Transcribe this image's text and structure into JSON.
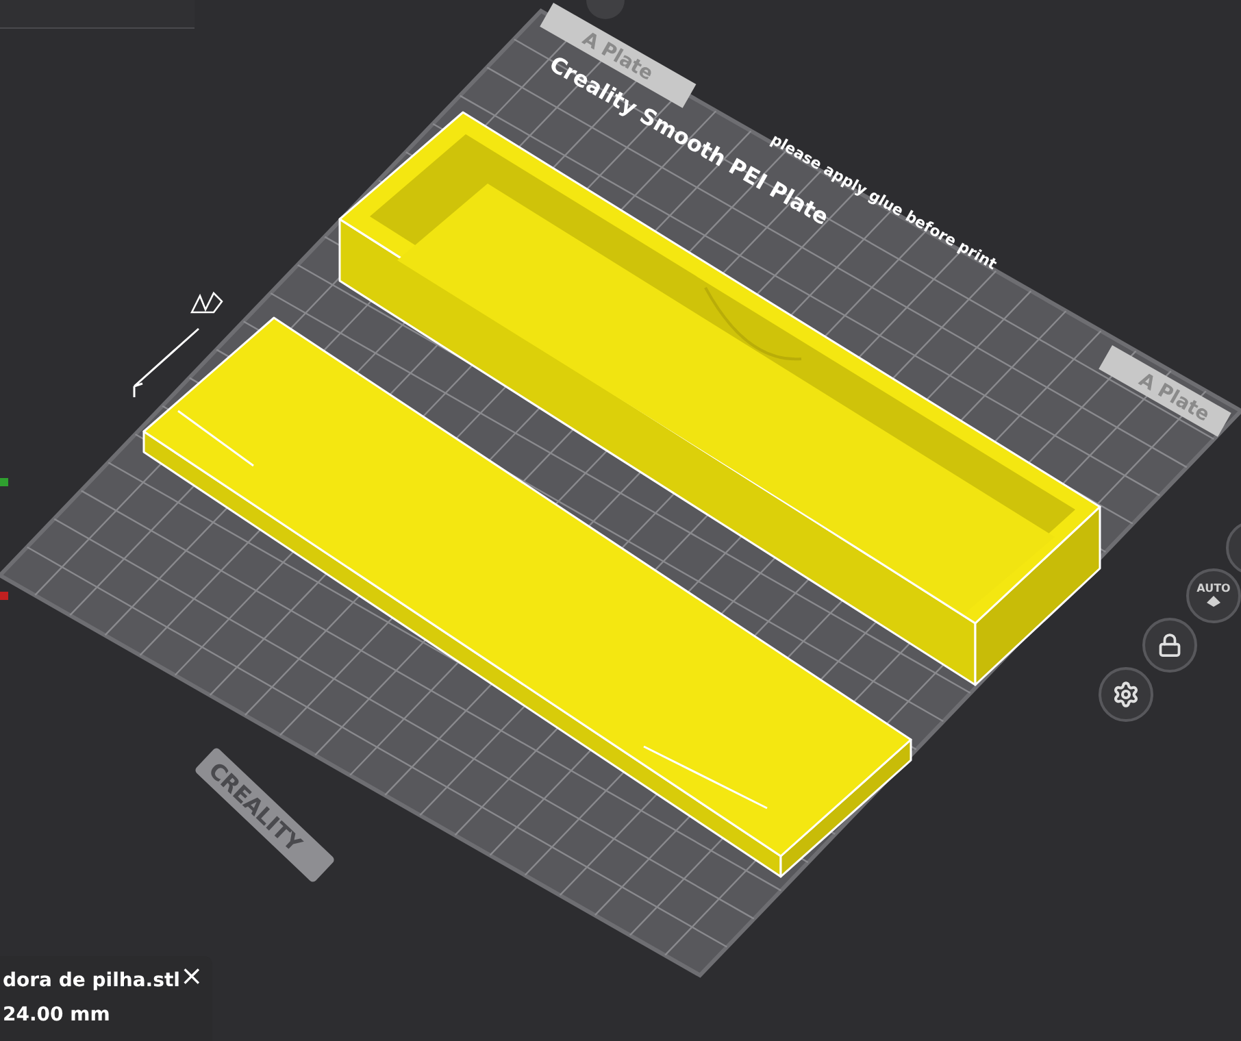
{
  "plate": {
    "tab_labels": [
      "A Plate",
      "A Plate"
    ],
    "name": "Creality Smooth PEI Plate",
    "note": "please apply glue before print",
    "logo": "CREALITY"
  },
  "toolbar": [
    {
      "kind": "auto",
      "label": "AUTO"
    },
    {
      "kind": "lock"
    },
    {
      "kind": "settings"
    }
  ],
  "object_info": {
    "name": "dora de pilha.stl",
    "size": "24.00 mm",
    "close": "×"
  }
}
